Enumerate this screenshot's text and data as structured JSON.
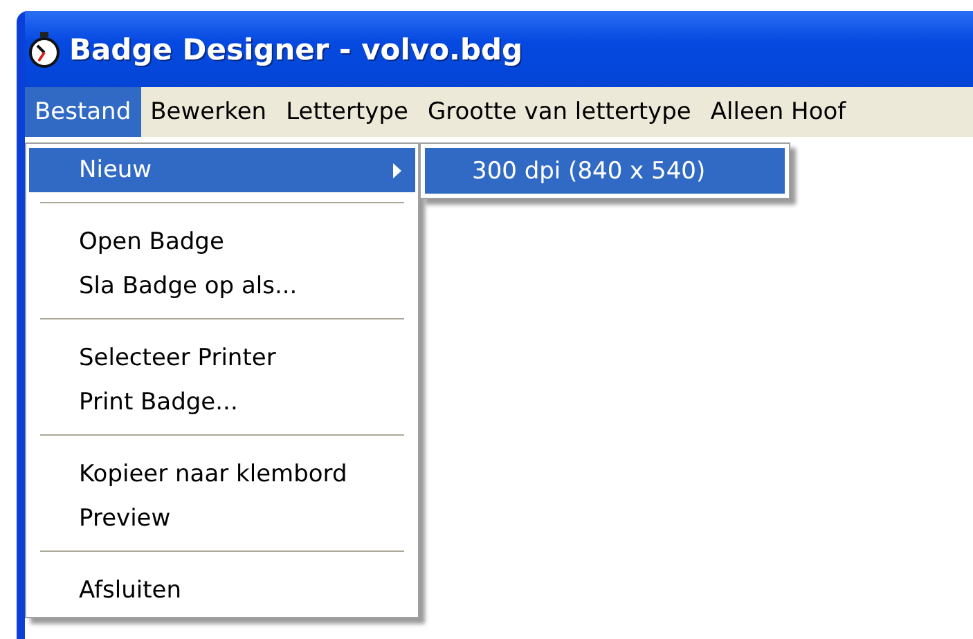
{
  "window": {
    "title": "Badge Designer - volvo.bdg"
  },
  "menubar": [
    {
      "label": "Bestand",
      "selected": true
    },
    {
      "label": "Bewerken",
      "selected": false
    },
    {
      "label": "Lettertype",
      "selected": false
    },
    {
      "label": "Grootte van lettertype",
      "selected": false
    },
    {
      "label": "Alleen Hoof",
      "selected": false
    }
  ],
  "menu": [
    {
      "kind": "item",
      "label": "Nieuw",
      "selected": true,
      "has_submenu": true
    },
    {
      "kind": "separator"
    },
    {
      "kind": "item",
      "label": "Open Badge",
      "selected": false,
      "has_submenu": false
    },
    {
      "kind": "item",
      "label": "Sla Badge op als...",
      "selected": false,
      "has_submenu": false
    },
    {
      "kind": "separator"
    },
    {
      "kind": "item",
      "label": "Selecteer Printer",
      "selected": false,
      "has_submenu": false
    },
    {
      "kind": "item",
      "label": "Print Badge...",
      "selected": false,
      "has_submenu": false
    },
    {
      "kind": "separator"
    },
    {
      "kind": "item",
      "label": "Kopieer naar klembord",
      "selected": false,
      "has_submenu": false
    },
    {
      "kind": "item",
      "label": "Preview",
      "selected": false,
      "has_submenu": false
    },
    {
      "kind": "separator"
    },
    {
      "kind": "item",
      "label": "Afsluiten",
      "selected": false,
      "has_submenu": false
    }
  ],
  "submenu": [
    {
      "label": "300 dpi (840 x 540)",
      "selected": true
    }
  ]
}
